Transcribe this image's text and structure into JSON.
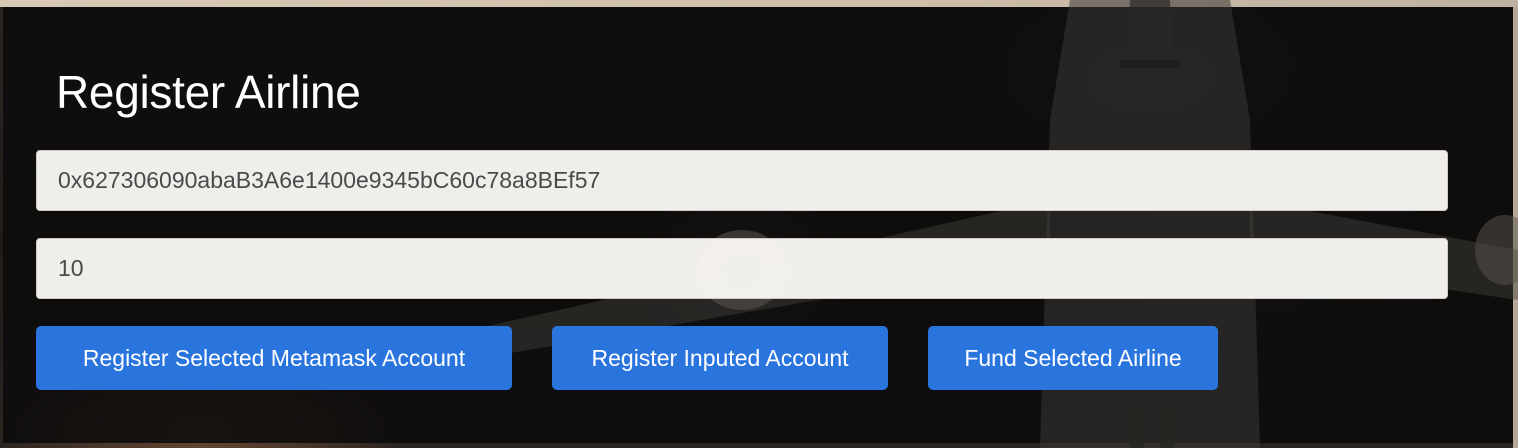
{
  "form": {
    "title": "Register Airline",
    "address_value": "0x627306090abaB3A6e1400e9345bC60c78a8BEf57",
    "amount_value": "10"
  },
  "buttons": {
    "register_selected": "Register Selected Metamask Account",
    "register_inputed": "Register Inputed Account",
    "fund_selected": "Fund Selected Airline"
  },
  "colors": {
    "panel_background": "#141210",
    "button_primary": "#2a74de",
    "input_background": "#f8f6f3",
    "title_text": "#ffffff"
  }
}
